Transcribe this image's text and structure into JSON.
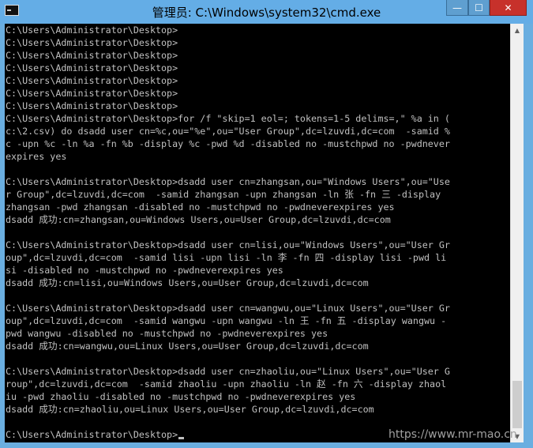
{
  "window": {
    "title": "管理员: C:\\Windows\\system32\\cmd.exe",
    "buttons": {
      "minimize": "—",
      "maximize": "☐",
      "close": "✕"
    }
  },
  "console": {
    "lines": [
      "C:\\Users\\Administrator\\Desktop>",
      "C:\\Users\\Administrator\\Desktop>",
      "C:\\Users\\Administrator\\Desktop>",
      "C:\\Users\\Administrator\\Desktop>",
      "C:\\Users\\Administrator\\Desktop>",
      "C:\\Users\\Administrator\\Desktop>",
      "C:\\Users\\Administrator\\Desktop>",
      "C:\\Users\\Administrator\\Desktop>for /f \"skip=1 eol=; tokens=1-5 delims=,\" %a in (",
      "c:\\2.csv) do dsadd user cn=%c,ou=\"%e\",ou=\"User Group\",dc=lzuvdi,dc=com  -samid %",
      "c -upn %c -ln %a -fn %b -display %c -pwd %d -disabled no -mustchpwd no -pwdnever",
      "expires yes",
      "",
      "C:\\Users\\Administrator\\Desktop>dsadd user cn=zhangsan,ou=\"Windows Users\",ou=\"Use",
      "r Group\",dc=lzuvdi,dc=com  -samid zhangsan -upn zhangsan -ln 张 -fn 三 -display",
      "zhangsan -pwd zhangsan -disabled no -mustchpwd no -pwdneverexpires yes",
      "dsadd 成功:cn=zhangsan,ou=Windows Users,ou=User Group,dc=lzuvdi,dc=com",
      "",
      "C:\\Users\\Administrator\\Desktop>dsadd user cn=lisi,ou=\"Windows Users\",ou=\"User Gr",
      "oup\",dc=lzuvdi,dc=com  -samid lisi -upn lisi -ln 李 -fn 四 -display lisi -pwd li",
      "si -disabled no -mustchpwd no -pwdneverexpires yes",
      "dsadd 成功:cn=lisi,ou=Windows Users,ou=User Group,dc=lzuvdi,dc=com",
      "",
      "C:\\Users\\Administrator\\Desktop>dsadd user cn=wangwu,ou=\"Linux Users\",ou=\"User Gr",
      "oup\",dc=lzuvdi,dc=com  -samid wangwu -upn wangwu -ln 王 -fn 五 -display wangwu -",
      "pwd wangwu -disabled no -mustchpwd no -pwdneverexpires yes",
      "dsadd 成功:cn=wangwu,ou=Linux Users,ou=User Group,dc=lzuvdi,dc=com",
      "",
      "C:\\Users\\Administrator\\Desktop>dsadd user cn=zhaoliu,ou=\"Linux Users\",ou=\"User G",
      "roup\",dc=lzuvdi,dc=com  -samid zhaoliu -upn zhaoliu -ln 赵 -fn 六 -display zhaol",
      "iu -pwd zhaoliu -disabled no -mustchpwd no -pwdneverexpires yes",
      "dsadd 成功:cn=zhaoliu,ou=Linux Users,ou=User Group,dc=lzuvdi,dc=com",
      "",
      "C:\\Users\\Administrator\\Desktop>"
    ]
  },
  "scrollbar": {
    "up": "▲",
    "down": "▼"
  },
  "watermark": "https://www.mr-mao.cn",
  "colors": {
    "console_bg": "#000000",
    "console_text": "#c0c0c0",
    "titlebar": "#64ade6",
    "close_button": "#c7312b"
  }
}
